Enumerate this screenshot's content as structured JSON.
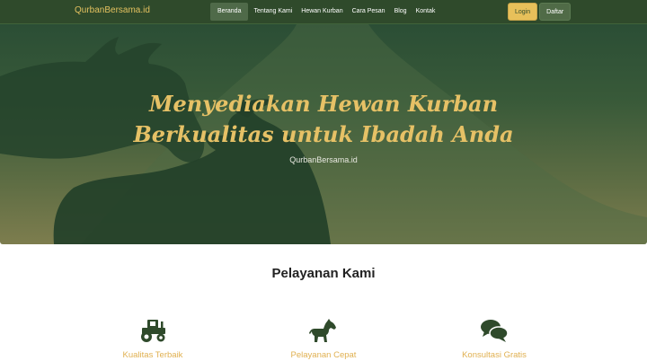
{
  "navbar": {
    "brand": "QurbanBersama.id",
    "links": [
      {
        "label": "Beranda",
        "active": true
      },
      {
        "label": "Tentang Kami"
      },
      {
        "label": "Hewan Kurban"
      },
      {
        "label": "Cara Pesan"
      },
      {
        "label": "Blog"
      },
      {
        "label": "Kontak"
      }
    ],
    "login_label": "Login",
    "signup_label": "Daftar"
  },
  "hero": {
    "title": "Menyediakan Hewan Kurban Berkualitas untuk Ibadah Anda",
    "subtitle": "QurbanBersama.id"
  },
  "services": {
    "title": "Pelayanan Kami",
    "items": [
      {
        "label": "Kualitas Terbaik",
        "icon": "tractor-icon"
      },
      {
        "label": "Pelayanan Cepat",
        "icon": "horse-icon"
      },
      {
        "label": "Konsultasi Gratis",
        "icon": "comments-icon"
      }
    ]
  },
  "colors": {
    "primary_green": "#2f4a2b",
    "accent_gold": "#e3c15f"
  }
}
